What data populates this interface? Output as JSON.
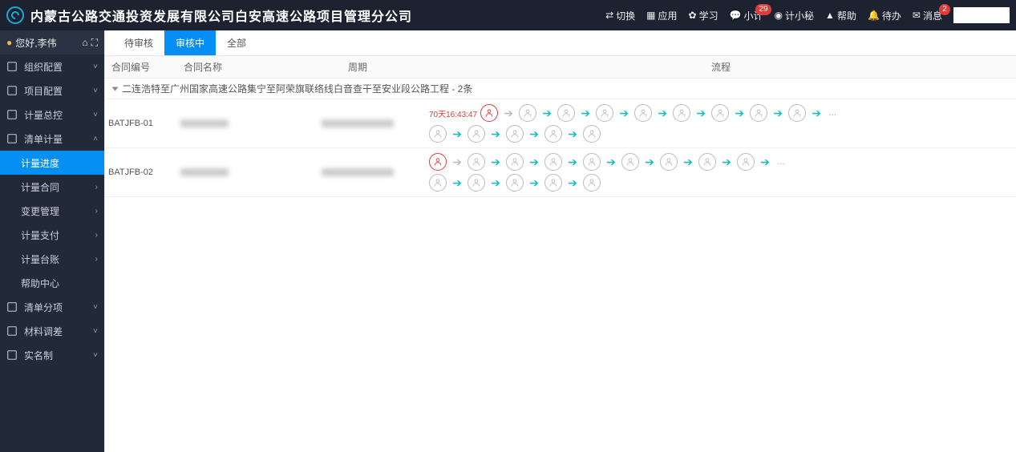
{
  "header": {
    "title": "内蒙古公路交通投资发展有限公司白安高速公路项目管理分公司",
    "nav": {
      "switch": "切换",
      "apps": "应用",
      "learn": "学习",
      "xiaoji": "小计",
      "xiaoji_badge": "29",
      "jixiaomi": "计小秘",
      "help": "帮助",
      "todo": "待办",
      "message": "消息",
      "message_badge": "2"
    }
  },
  "user": {
    "greet": "您好,李伟"
  },
  "sidebar": [
    {
      "label": "组织配置",
      "type": "top"
    },
    {
      "label": "项目配置",
      "type": "top"
    },
    {
      "label": "计量总控",
      "type": "top"
    },
    {
      "label": "清单计量",
      "type": "top",
      "open": true
    },
    {
      "label": "计量进度",
      "type": "sub",
      "active": true
    },
    {
      "label": "计量合同",
      "type": "sub",
      "caret": true
    },
    {
      "label": "变更管理",
      "type": "sub",
      "caret": true
    },
    {
      "label": "计量支付",
      "type": "sub",
      "caret": true
    },
    {
      "label": "计量台账",
      "type": "sub",
      "caret": true
    },
    {
      "label": "帮助中心",
      "type": "sub"
    },
    {
      "label": "清单分项",
      "type": "top"
    },
    {
      "label": "材料调差",
      "type": "top"
    },
    {
      "label": "实名制",
      "type": "top"
    }
  ],
  "tabs": [
    {
      "label": "待审核"
    },
    {
      "label": "审核中",
      "active": true
    },
    {
      "label": "全部"
    }
  ],
  "columns": {
    "a": "合同编号",
    "b": "合同名称",
    "c": "周期",
    "d": "流程"
  },
  "group": {
    "title": "二连浩特至广州国家高速公路集宁至阿荣旗联络线白音查干至安业段公路工程 - 2条"
  },
  "rows": [
    {
      "id": "BATJFB-01",
      "lines": [
        {
          "time": "70天16:43:47",
          "start_red": true,
          "start_arrow": "gray",
          "nodes": 8,
          "trail": "…"
        },
        {
          "start_red": false,
          "start_arrow": "teal",
          "nodes": 4
        }
      ]
    },
    {
      "id": "BATJFB-02",
      "lines": [
        {
          "time": "",
          "start_red": true,
          "start_arrow": "gray",
          "nodes": 8,
          "trail": "…"
        },
        {
          "start_red": false,
          "start_arrow": "teal",
          "nodes": 4
        }
      ]
    }
  ]
}
